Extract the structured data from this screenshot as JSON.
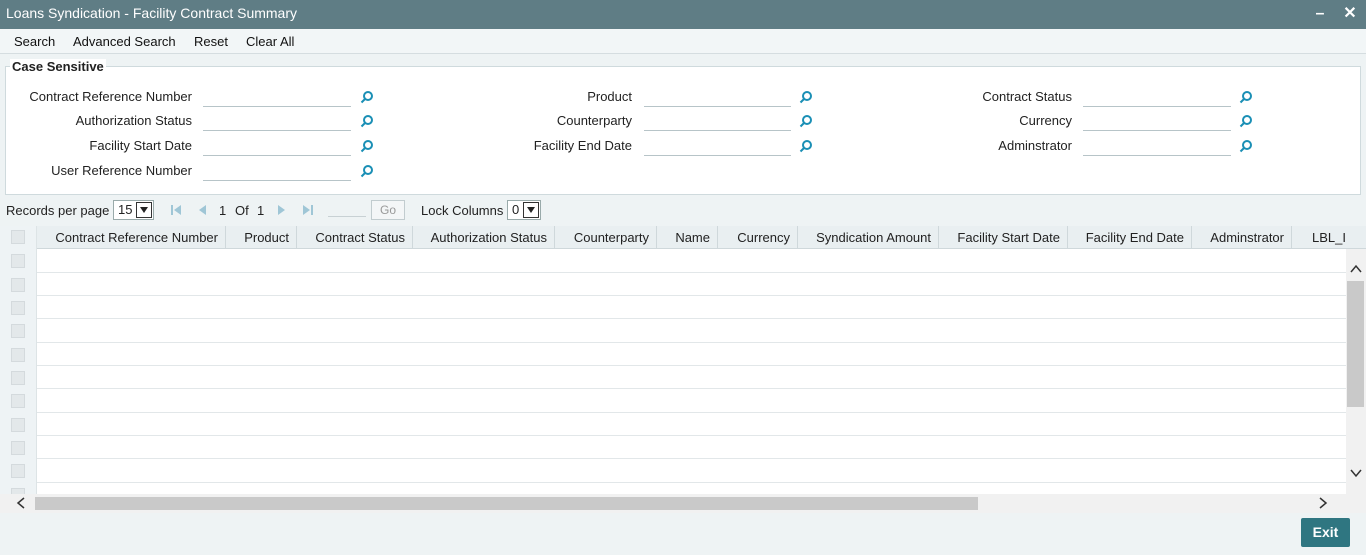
{
  "window": {
    "title": "Loans Syndication - Facility Contract Summary"
  },
  "toolbar": {
    "search": "Search",
    "advanced_search": "Advanced Search",
    "reset": "Reset",
    "clear_all": "Clear All"
  },
  "criteria": {
    "legend": "Case Sensitive",
    "fields": {
      "contract_reference_number": {
        "label": "Contract Reference Number",
        "value": ""
      },
      "authorization_status": {
        "label": "Authorization Status",
        "value": ""
      },
      "facility_start_date": {
        "label": "Facility Start Date",
        "value": ""
      },
      "user_reference_number": {
        "label": "User Reference Number",
        "value": ""
      },
      "product": {
        "label": "Product",
        "value": ""
      },
      "counterparty": {
        "label": "Counterparty",
        "value": ""
      },
      "facility_end_date": {
        "label": "Facility End Date",
        "value": ""
      },
      "contract_status": {
        "label": "Contract Status",
        "value": ""
      },
      "currency": {
        "label": "Currency",
        "value": ""
      },
      "adminstrator": {
        "label": "Adminstrator",
        "value": ""
      }
    }
  },
  "pager": {
    "records_label": "Records per page",
    "records_value": "15",
    "page_current": "1",
    "of_label": "Of",
    "page_total": "1",
    "go_label": "Go",
    "lock_label": "Lock Columns",
    "lock_value": "0"
  },
  "grid": {
    "columns": [
      "Contract Reference Number",
      "Product",
      "Contract Status",
      "Authorization Status",
      "Counterparty",
      "Name",
      "Currency",
      "Syndication Amount",
      "Facility Start Date",
      "Facility End Date",
      "Adminstrator",
      "LBL_I"
    ]
  },
  "footer": {
    "exit": "Exit"
  },
  "colors": {
    "titlebar": "#5f7d85",
    "accent": "#2f7681",
    "lov_icon": "#1a8fb5"
  }
}
